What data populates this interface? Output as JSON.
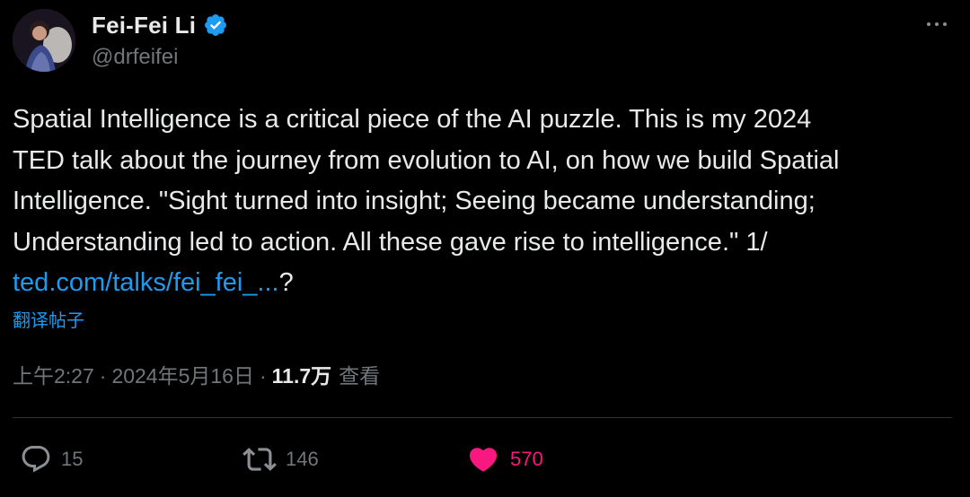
{
  "author": {
    "display_name": "Fei-Fei Li",
    "handle": "@drfeifei",
    "verified": true,
    "verified_color": "#1d9bf0"
  },
  "tweet": {
    "text_lines": [
      "Spatial Intelligence is a critical piece of the AI puzzle. This is my 2024",
      "TED talk about the journey from evolution to AI, on how we build Spatial",
      "Intelligence. \"Sight turned into insight; Seeing became understanding;",
      "Understanding led to action. All these gave rise to intelligence.\" 1/"
    ],
    "link_text": "ted.com/talks/fei_fei_...",
    "link_suffix": "?",
    "translate_label": "翻译帖子"
  },
  "meta": {
    "time": "上午2:27",
    "separator": "·",
    "date": "2024年5月16日",
    "views_count": "11.7万",
    "views_label": "查看"
  },
  "actions": {
    "replies": "15",
    "retweets": "146",
    "likes": "570"
  },
  "colors": {
    "background": "#000000",
    "text": "#e7e9ea",
    "secondary": "#71767b",
    "link": "#1d9bf0",
    "like": "#f91880",
    "divider": "#2f3336"
  },
  "icons": {
    "more": "more-horizontal-icon",
    "verified": "verified-badge-icon",
    "reply": "reply-icon",
    "retweet": "retweet-icon",
    "like": "heart-icon"
  }
}
